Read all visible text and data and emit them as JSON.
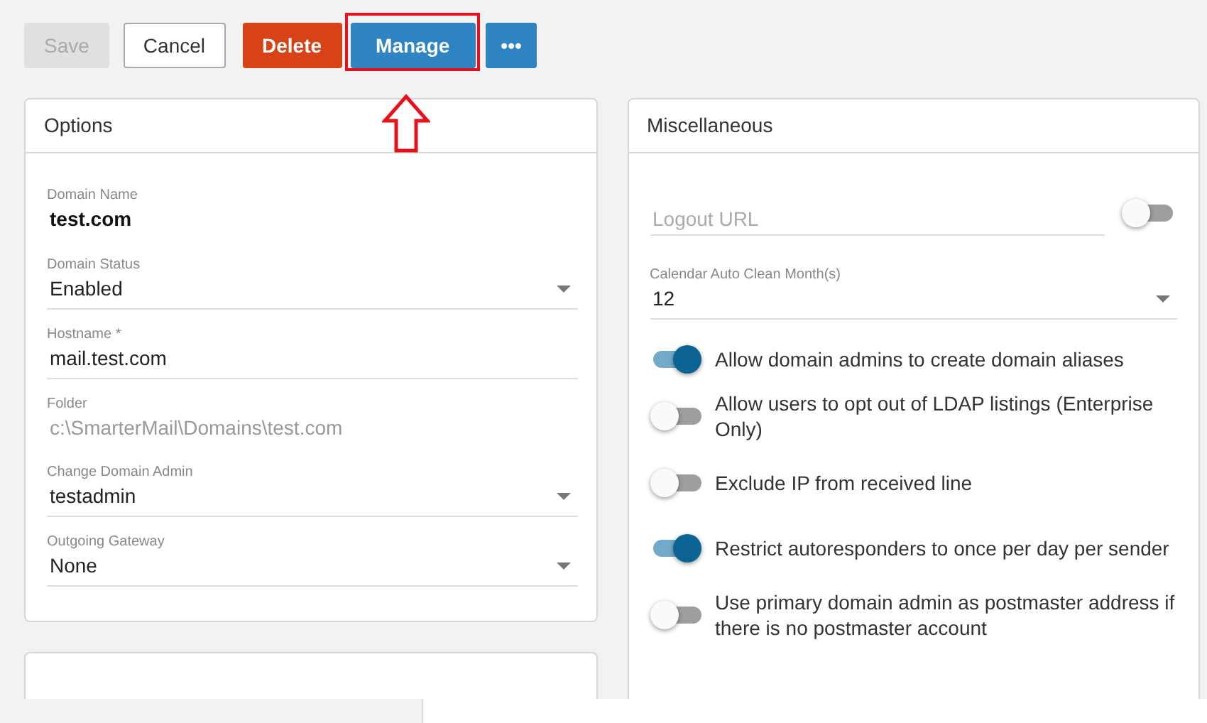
{
  "toolbar": {
    "buttons": [
      {
        "label": "Save",
        "kind": "default",
        "disabled": true,
        "highlighted": false
      },
      {
        "label": "Cancel",
        "kind": "default",
        "disabled": false,
        "highlighted": false
      },
      {
        "label": "Delete",
        "kind": "danger",
        "disabled": false,
        "highlighted": false
      },
      {
        "label": "Manage",
        "kind": "primary",
        "disabled": false,
        "highlighted": true
      },
      {
        "label": "•••",
        "kind": "primary",
        "disabled": false,
        "highlighted": false
      }
    ]
  },
  "options": {
    "title": "Options",
    "fields": [
      {
        "label": "Domain Name",
        "value": "test.com",
        "kind": "static"
      },
      {
        "label": "Domain Status",
        "value": "Enabled",
        "kind": "select"
      },
      {
        "label": "Hostname *",
        "value": "mail.test.com",
        "kind": "text"
      },
      {
        "label": "Folder",
        "value": "c:\\SmarterMail\\Domains\\test.com",
        "kind": "readonly"
      },
      {
        "label": "Change Domain Admin",
        "value": "testadmin",
        "kind": "select"
      },
      {
        "label": "Outgoing Gateway",
        "value": "None",
        "kind": "select"
      }
    ]
  },
  "miscellaneous": {
    "title": "Miscellaneous",
    "logout_url": {
      "placeholder": "Logout URL",
      "on": false
    },
    "calendar": {
      "label": "Calendar Auto Clean Month(s)",
      "value": "12"
    },
    "toggles": [
      {
        "label": "Allow domain admins to create domain aliases",
        "on": true
      },
      {
        "label": "Allow users to opt out of LDAP listings (Enterprise Only)",
        "on": false
      },
      {
        "label": "Exclude IP from received line",
        "on": false
      },
      {
        "label": "Restrict autoresponders to once per day per sender",
        "on": true
      },
      {
        "label": "Use primary domain admin as postmaster address if there is no postmaster account",
        "on": false
      }
    ]
  }
}
